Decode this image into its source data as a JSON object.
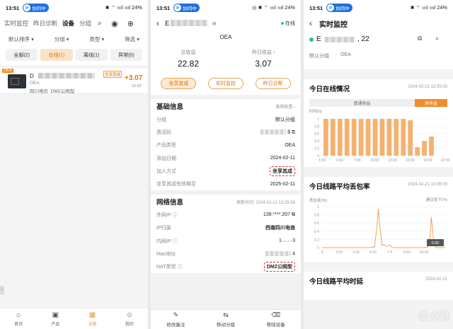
{
  "status": {
    "time": "13:51",
    "sync_label": "协同中",
    "right_p1": "✱ ⌔ ıııl ıııl 24%",
    "right_p2": "◎ ✱ ⌔ ıııl ıııl 24%",
    "right_p3": "✱ ⌔ ıııl ıııl 24%"
  },
  "panel1": {
    "tabs": [
      "实时监控",
      "昨日诊断",
      "设备",
      "分组"
    ],
    "active_tab": "设备",
    "filters": [
      "默认排序",
      "分组",
      "类型",
      "筛选"
    ],
    "chips": [
      {
        "label": "全部(2)",
        "active": false
      },
      {
        "label": "在线(1)",
        "active": true
      },
      {
        "label": "离线(1)",
        "active": false
      },
      {
        "label": "异常(0)",
        "active": false
      }
    ],
    "device": {
      "corner_tag": "OEA",
      "name_prefix": "D",
      "type": "OEA",
      "location": "四川电信",
      "nat": "DMZ公网型",
      "share_tag": "坐享其成",
      "amount": "+3.07",
      "date": "22.82"
    },
    "bottom_nav": [
      "首页",
      "产品",
      "设备",
      "我的"
    ],
    "bottom_active": "设备",
    "side_handle": "‹"
  },
  "panel2": {
    "title_prefix": "E",
    "signal_glyph": "≋",
    "online": "在线",
    "device_type": "OEA",
    "total_label": "总收益",
    "total_value": "22.82",
    "yesterday_label": "昨日收益 ›",
    "yesterday_value": "3.07",
    "buttons": [
      "坐享其成",
      "实时监控",
      "昨日诊断"
    ],
    "basic": {
      "title": "基础信息",
      "extra": "推荐配置 ›",
      "rows": [
        {
          "k": "分组",
          "v": "默认分组"
        },
        {
          "k": "激活码",
          "v": "$"
        },
        {
          "k": "产品类型",
          "v": "OEA"
        },
        {
          "k": "添加日期",
          "v": "2024-02-11"
        },
        {
          "k": "加入方式",
          "v": "坐享其成"
        },
        {
          "k": "坐享其成有效期至",
          "v": "2025-02-11"
        }
      ]
    },
    "network": {
      "title": "网络信息",
      "extra": "更新时间: 2024-02-21  13:25:56",
      "rows": [
        {
          "k": "外网IP",
          "v": "139.****.207"
        },
        {
          "k": "IP归属",
          "v": "西南四川电信"
        },
        {
          "k": "内网IP",
          "v": "1·.·.·.·3"
        },
        {
          "k": "Mac地址",
          "v": "4"
        },
        {
          "k": "NAT类型",
          "v": "DMZ公网型"
        }
      ]
    },
    "bottom": [
      "修改备注",
      "移动分组",
      "移除设备"
    ]
  },
  "panel3": {
    "title": "实时监控",
    "device_prefix": "E",
    "device_suffix": ", 22",
    "group": "默认分组",
    "type": "OEA",
    "online_title": "今日在线情况",
    "online_time": "2024-02-21  13:35:00",
    "seg_a": "普通收益",
    "seg_b": "高收益",
    "online_ylabel": "时间(h)",
    "loss_title": "今日线路平均丢包率",
    "loss_time": "2024-02-21  13:35:00",
    "loss_ylabel": "丢包率(%)",
    "loss_hint": "建议低于2%",
    "loss_value": "0.00",
    "delay_title": "今日线路平均时延",
    "delay_time": "2024-02-21",
    "watermark": "值·众测",
    "icons_text": "⧉ ⌕"
  },
  "chart_data": [
    {
      "type": "bar",
      "title": "今日在线情况",
      "ylabel": "时间(h)",
      "x_ticks": [
        "1:00",
        "4:00",
        "7:00",
        "10:00",
        "13:00",
        "16:00",
        "19:00",
        "22:00"
      ],
      "y_ticks": [
        "1",
        "0.8",
        "0.6",
        "0.4",
        "0.2",
        "0"
      ],
      "ylim": [
        0,
        1
      ],
      "values": [
        1,
        1,
        1,
        1,
        1,
        1,
        1,
        1,
        1,
        1,
        1,
        1,
        0.96,
        0.23,
        0.4,
        0.52
      ],
      "highlight": [
        true,
        true,
        true,
        true,
        true,
        true,
        true,
        true,
        true,
        true,
        true,
        true,
        true,
        true,
        true,
        true
      ]
    },
    {
      "type": "line",
      "title": "今日线路平均丢包率",
      "ylabel": "丢包率(%)",
      "x_ticks": [
        "0",
        "1:50",
        "3:35",
        "5:20",
        "7:5",
        "8:50",
        "10:35"
      ],
      "y_ticks": [
        "1",
        "0.8",
        "0.6",
        "0.4",
        "0.2",
        "0"
      ],
      "ylim": [
        0,
        1
      ],
      "x": [
        0,
        0.5,
        1,
        1.5,
        2,
        2.5,
        3,
        3.5,
        4,
        4.5,
        4.9,
        5.1,
        5.25,
        5.4,
        5.6,
        5.8,
        6,
        6.3,
        6.6,
        7,
        7.5,
        8,
        8.5,
        9,
        9.5,
        9.9,
        10.1,
        10.2,
        10.4,
        10.6,
        11,
        11.5
      ],
      "y": [
        0,
        0,
        0,
        0,
        0,
        0,
        0,
        0,
        0,
        0,
        0.02,
        0.45,
        0.95,
        0.5,
        0.05,
        0.08,
        0.03,
        0.06,
        0,
        0,
        0,
        0,
        0,
        0,
        0,
        0.02,
        0.3,
        0.75,
        0.2,
        0,
        0,
        0
      ]
    }
  ]
}
